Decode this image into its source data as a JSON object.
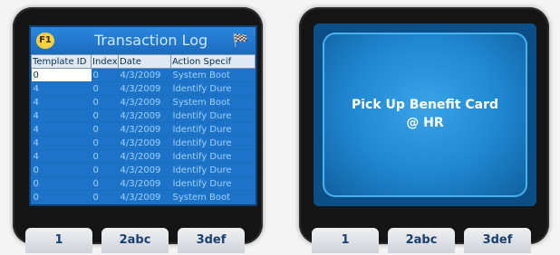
{
  "left_device": {
    "title": "Transaction Log",
    "badge": "F1",
    "title_icon": "🏁",
    "columns": [
      "Template ID",
      "Index",
      "Date",
      "Action Specif"
    ],
    "rows": [
      [
        "0",
        "0",
        "4/3/2009",
        "System Boot"
      ],
      [
        "4",
        "0",
        "4/3/2009",
        "Identify Dure"
      ],
      [
        "4",
        "0",
        "4/3/2009",
        "System Boot"
      ],
      [
        "4",
        "0",
        "4/3/2009",
        "Identify Dure"
      ],
      [
        "4",
        "0",
        "4/3/2009",
        "Identify Dure"
      ],
      [
        "4",
        "0",
        "4/3/2009",
        "Identify Dure"
      ],
      [
        "4",
        "0",
        "4/3/2009",
        "Identify Dure"
      ],
      [
        "0",
        "0",
        "4/3/2009",
        "Identify Dure"
      ],
      [
        "0",
        "0",
        "4/3/2009",
        "Identify Dure"
      ],
      [
        "0",
        "0",
        "4/3/2009",
        "System Boot"
      ]
    ],
    "keys": [
      "1",
      "2abc",
      "3def"
    ]
  },
  "right_device": {
    "message_line1": "Pick Up Benefit Card",
    "message_line2": "@ HR",
    "keys": [
      "1",
      "2abc",
      "3def"
    ]
  },
  "colors": {
    "screen_blue": "#1d73c8",
    "title_text": "#cfe6ff",
    "card_blue": "#2a96e0"
  }
}
